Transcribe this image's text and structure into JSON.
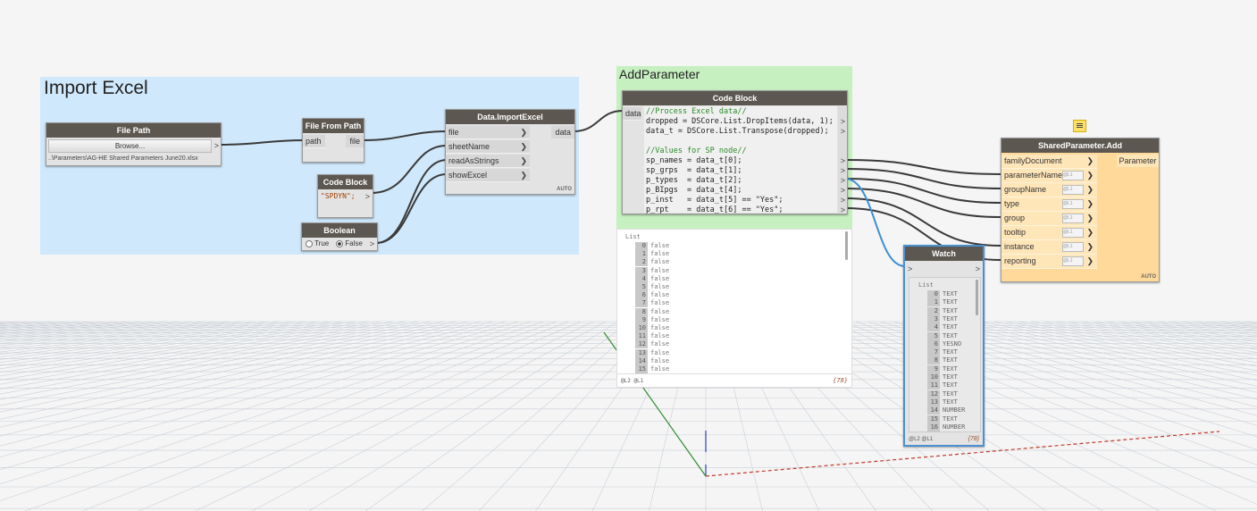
{
  "groups": {
    "import_excel": {
      "title": "Import Excel",
      "color": "#cfe8fb"
    },
    "add_parameter": {
      "title": "AddParameter",
      "color": "#c6f0c0"
    }
  },
  "file_path": {
    "title": "File Path",
    "browse_label": "Browse...",
    "value": "..\\Parameters\\AG-HE Shared Parameters June20.xlsx",
    "out_arrow": ">"
  },
  "file_from_path": {
    "title": "File From Path",
    "input": "path",
    "output": "file"
  },
  "code_block_small": {
    "title": "Code Block",
    "code": "\"SPDYN\";",
    "out_arrow": ">"
  },
  "boolean": {
    "title": "Boolean",
    "true_label": "True",
    "false_label": "False",
    "selected": "False",
    "out_arrow": ">"
  },
  "import_excel_node": {
    "title": "Data.ImportExcel",
    "inputs": [
      "file",
      "sheetName",
      "readAsStrings",
      "showExcel"
    ],
    "output": "data",
    "auto": "AUTO"
  },
  "code_block_main": {
    "title": "Code Block",
    "input": "data",
    "lines": [
      "//Process Excel data//",
      "dropped = DSCore.List.DropItems(data, 1);",
      "data_t = DSCore.List.Transpose(dropped);",
      "",
      "//Values for SP node//",
      "sp_names = data_t[0];",
      "sp_grps  = data_t[1];",
      "p_types  = data_t[2];",
      "p_BIpgs  = data_t[4];",
      "p_inst   = data_t[5] == \"Yes\";",
      "p_rpt    = data_t[6] == \"Yes\";"
    ]
  },
  "code_preview": {
    "header": "List",
    "items": [
      {
        "i": "0",
        "v": "false"
      },
      {
        "i": "1",
        "v": "false"
      },
      {
        "i": "2",
        "v": "false"
      },
      {
        "i": "3",
        "v": "false"
      },
      {
        "i": "4",
        "v": "false"
      },
      {
        "i": "5",
        "v": "false"
      },
      {
        "i": "6",
        "v": "false"
      },
      {
        "i": "7",
        "v": "false"
      },
      {
        "i": "8",
        "v": "false"
      },
      {
        "i": "9",
        "v": "false"
      },
      {
        "i": "10",
        "v": "false"
      },
      {
        "i": "11",
        "v": "false"
      },
      {
        "i": "12",
        "v": "false"
      },
      {
        "i": "13",
        "v": "false"
      },
      {
        "i": "14",
        "v": "false"
      },
      {
        "i": "15",
        "v": "false"
      }
    ],
    "levels": "@L2 @L1",
    "count": "{78}"
  },
  "watch": {
    "title": "Watch",
    "header": "List",
    "items": [
      {
        "i": "0",
        "v": "TEXT"
      },
      {
        "i": "1",
        "v": "TEXT"
      },
      {
        "i": "2",
        "v": "TEXT"
      },
      {
        "i": "3",
        "v": "TEXT"
      },
      {
        "i": "4",
        "v": "TEXT"
      },
      {
        "i": "5",
        "v": "TEXT"
      },
      {
        "i": "6",
        "v": "YESNO"
      },
      {
        "i": "7",
        "v": "TEXT"
      },
      {
        "i": "8",
        "v": "TEXT"
      },
      {
        "i": "9",
        "v": "TEXT"
      },
      {
        "i": "10",
        "v": "TEXT"
      },
      {
        "i": "11",
        "v": "TEXT"
      },
      {
        "i": "12",
        "v": "TEXT"
      },
      {
        "i": "13",
        "v": "TEXT"
      },
      {
        "i": "14",
        "v": "NUMBER"
      },
      {
        "i": "15",
        "v": "TEXT"
      },
      {
        "i": "16",
        "v": "NUMBER"
      }
    ],
    "levels": "@L2 @L1",
    "count": "{78}"
  },
  "shared_param": {
    "title": "SharedParameter.Add",
    "inputs": [
      "familyDocument",
      "parameterName",
      "groupName",
      "type",
      "group",
      "tooltip",
      "instance",
      "reporting"
    ],
    "output": "Parameter",
    "lacing": "@L1",
    "auto": "AUTO"
  }
}
